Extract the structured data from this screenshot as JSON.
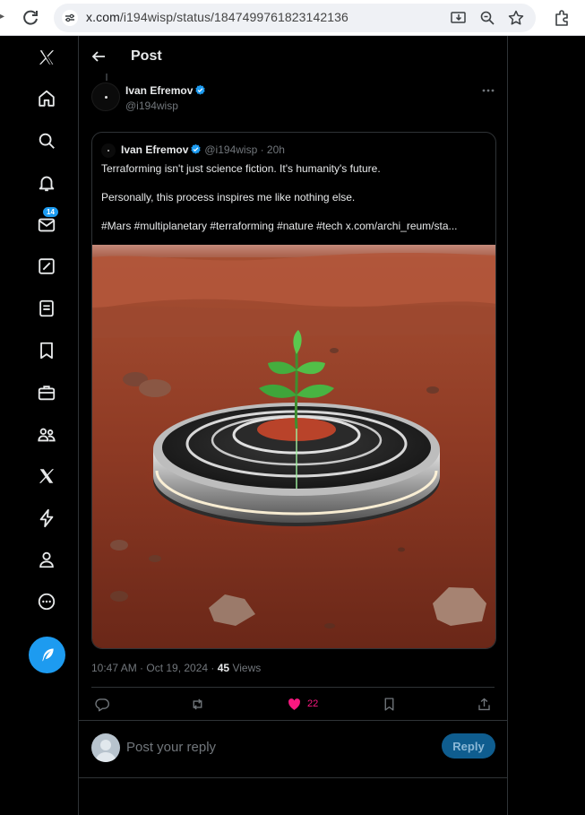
{
  "browser": {
    "url_host": "x.com",
    "url_path": "/i194wisp/status/1847499761823142136"
  },
  "nav": {
    "notifications_badge": "14"
  },
  "header": {
    "title": "Post"
  },
  "post": {
    "author_name": "Ivan Efremov",
    "author_handle": "@i194wisp",
    "timestamp": "10:47 AM · Oct 19, 2024 · ",
    "views_count": "45",
    "views_label": "Views",
    "like_count": "22"
  },
  "quoted": {
    "author_name": "Ivan Efremov",
    "meta": "@i194wisp · 20h",
    "lines": [
      "Terraforming isn't just science fiction. It's humanity's future.",
      "Personally, this process inspires me like nothing else.",
      "#Mars #multiplanetary #terraforming #nature #tech  x.com/archi_reum/sta..."
    ]
  },
  "reply": {
    "placeholder": "Post your reply",
    "button_label": "Reply"
  },
  "colors": {
    "accent": "#1d9bf0",
    "like": "#f91880",
    "background": "#000000",
    "border": "#2f3336"
  }
}
